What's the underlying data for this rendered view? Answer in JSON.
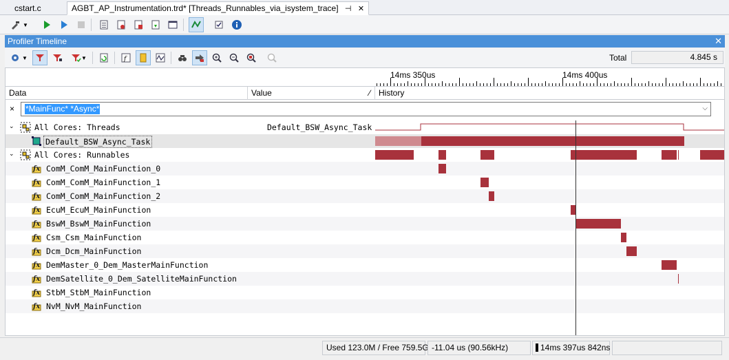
{
  "doc_tabs": [
    {
      "label": "cstart.c"
    },
    {
      "label": "AGBT_AP_Instrumentation.trd* [Threads_Runnables_via_isystem_trace]",
      "pin": "⊣",
      "close": "✕"
    }
  ],
  "panel": {
    "title": "Profiler Timeline",
    "close": "✕"
  },
  "total": {
    "label": "Total",
    "value": "4.845 s"
  },
  "ruler": {
    "label_left": "14ms 350us",
    "label_right": "14ms 400us"
  },
  "columns": {
    "data": "Data",
    "value": "Value",
    "history": "History",
    "sort_icon": "∕"
  },
  "filter": {
    "clear": "×",
    "value": "*MainFunc* *Async*",
    "dropdown": "⌵"
  },
  "tree": [
    {
      "label": "All Cores: Threads",
      "value": "Default_BSW_Async_Task",
      "icon": "thread-group-icon",
      "expanded": "⌄"
    },
    {
      "label": "Default_BSW_Async_Task",
      "icon": "task-icon",
      "selected": true
    },
    {
      "label": "All Cores: Runnables",
      "icon": "runnable-group-icon",
      "expanded": "⌄"
    },
    {
      "label": "ComM_ComM_MainFunction_0",
      "icon": "function-icon"
    },
    {
      "label": "ComM_ComM_MainFunction_1",
      "icon": "function-icon"
    },
    {
      "label": "ComM_ComM_MainFunction_2",
      "icon": "function-icon"
    },
    {
      "label": "EcuM_EcuM_MainFunction",
      "icon": "function-icon"
    },
    {
      "label": "BswM_BswM_MainFunction",
      "icon": "function-icon"
    },
    {
      "label": "Csm_Csm_MainFunction",
      "icon": "function-icon"
    },
    {
      "label": "Dcm_Dcm_MainFunction",
      "icon": "function-icon"
    },
    {
      "label": "DemMaster_0_Dem_MasterMainFunction",
      "icon": "function-icon"
    },
    {
      "label": "DemSatellite_0_Dem_SatelliteMainFunction",
      "icon": "function-icon"
    },
    {
      "label": "StbM_StbM_MainFunction",
      "icon": "function-icon"
    },
    {
      "label": "NvM_NvM_MainFunction",
      "icon": "function-icon"
    }
  ],
  "status": {
    "memory": "Used 123.0M / Free 759.5G",
    "delta": "-11.04 us (90.56kHz)",
    "cursor_time": "14ms 397us 842ns"
  },
  "colors": {
    "bar": "#a8323c",
    "bar_light": "#cf8a8f",
    "panel_header": "#4a90d9",
    "selection": "#3399ff"
  }
}
